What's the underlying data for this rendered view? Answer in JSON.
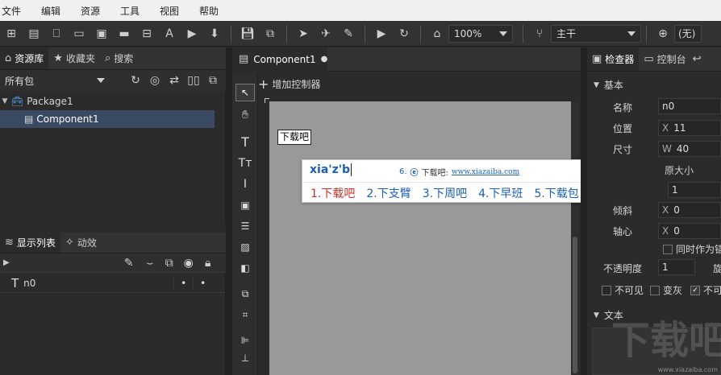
{
  "menu": [
    "文件",
    "编辑",
    "资源",
    "工具",
    "视图",
    "帮助"
  ],
  "toolbar": {
    "zoom": "100%",
    "branch": "主干",
    "lang": "(无)"
  },
  "assets": {
    "tabs": [
      "资源库",
      "收藏夹",
      "搜索"
    ],
    "package_filter": "所有包",
    "tree": [
      {
        "label": "Package1"
      },
      {
        "label": "Component1"
      }
    ]
  },
  "display": {
    "tabs": [
      "显示列表",
      "动效"
    ],
    "items": [
      {
        "label": "n0",
        "d1": "•",
        "d2": "•"
      }
    ]
  },
  "editor": {
    "tab": "Component1",
    "add_controller": "增加控制器",
    "node_label": "下载吧"
  },
  "ime": {
    "composition": "xia'z'b",
    "ad_prefix": "6.",
    "ad_text": "下载吧:",
    "ad_url": "www.xiazaiba.com",
    "candidates": [
      "1.下载吧",
      "2.下支臂",
      "3.下周吧",
      "4.下早班",
      "5.下载包"
    ],
    "prev": "‹",
    "next": "›",
    "logo": "S"
  },
  "inspector": {
    "tabs": [
      "检查器",
      "控制台"
    ],
    "section_basic": "基本",
    "name_label": "名称",
    "name_value": "n0",
    "pos_label": "位置",
    "pos_axis": "X",
    "pos_value": "11",
    "size_label": "尺寸",
    "size_axis": "W",
    "size_value": "40",
    "partial_text": "原大小",
    "scale_value": "1",
    "skew_label": "倾斜",
    "skew_axis": "X",
    "skew_value": "0",
    "pivot_label": "轴心",
    "pivot_axis": "X",
    "pivot_value": "0",
    "pivot_check": "同时作为锚",
    "opacity_label": "不透明度",
    "opacity_value": "1",
    "rotate_partial": "旋",
    "invisible": "不可见",
    "gray": "变灰",
    "not_touch": "不可",
    "section_text": "文本"
  },
  "watermark": {
    "text": "下载吧",
    "url": "www.xiazaiba.com"
  },
  "colors": {
    "accent": "#3b4a63",
    "ime_blue": "#1b5fb4",
    "ime_red": "#c8312b",
    "sogou_orange": "#f26b1d"
  }
}
